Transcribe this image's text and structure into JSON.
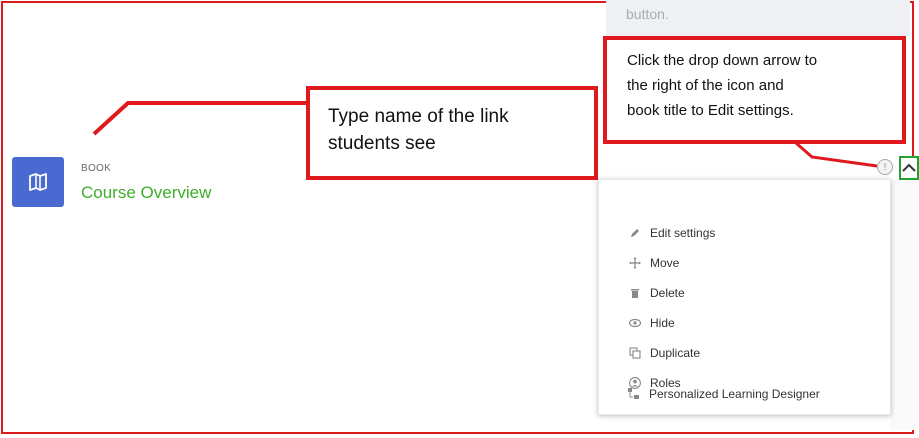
{
  "activity": {
    "type": "BOOK",
    "name": "Course Overview",
    "icon": "book-icon"
  },
  "callouts": {
    "left": {
      "line1": "Type name of the link",
      "line2": "students see"
    },
    "previous_tip": "button.",
    "right": {
      "line1": "Click the drop down arrow to",
      "line2": "the right of the icon and",
      "line3": "book title to Edit settings."
    }
  },
  "info_icon_glyph": "!",
  "menu": {
    "items": [
      {
        "label": "Edit settings",
        "icon": "pencil-icon"
      },
      {
        "label": "Move",
        "icon": "move-icon"
      },
      {
        "label": "Delete",
        "icon": "trash-icon"
      },
      {
        "label": "Hide",
        "icon": "eye-icon"
      },
      {
        "label": "Duplicate",
        "icon": "duplicate-icon"
      },
      {
        "label": "Roles",
        "icon": "user-icon"
      },
      {
        "label": "Personalized Learning Designer",
        "icon": "pld-icon"
      }
    ]
  },
  "colors": {
    "annotation_red": "#e0191e",
    "icon_bg": "#4a6ad1",
    "link_green": "#3fae2a",
    "toggle_border": "#22a32e"
  }
}
